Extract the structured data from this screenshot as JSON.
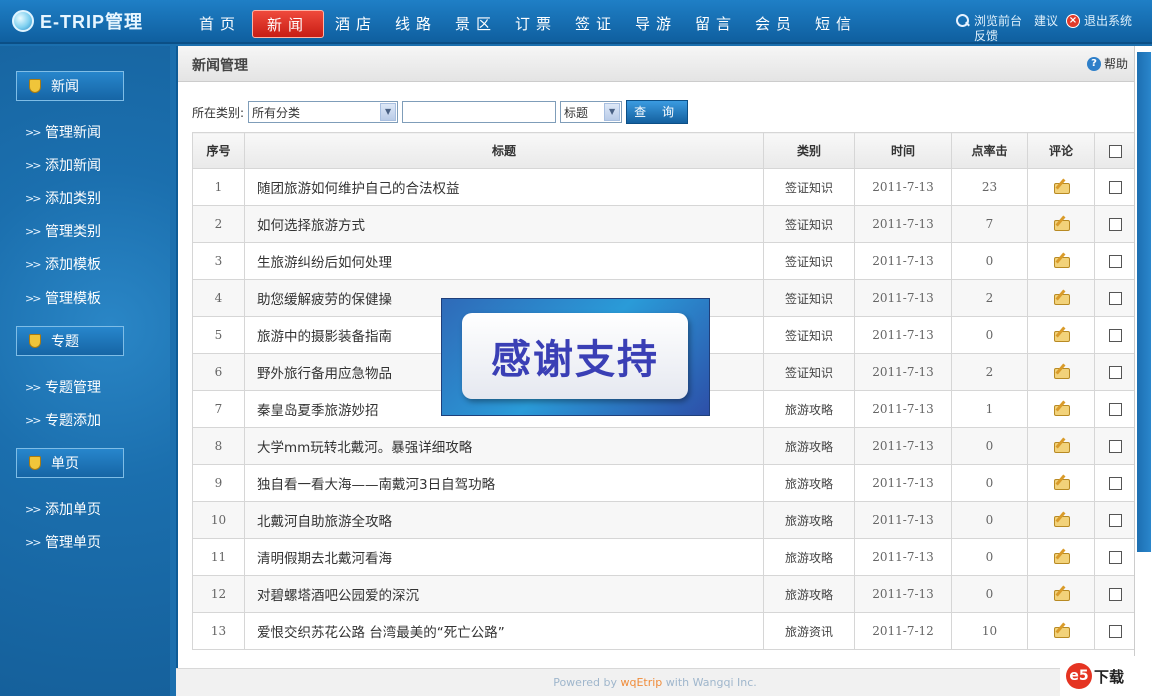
{
  "header": {
    "logo_text": "E-TRIP管理",
    "nav": [
      {
        "label": "首页",
        "active": false
      },
      {
        "label": "新闻",
        "active": true
      },
      {
        "label": "酒店",
        "active": false
      },
      {
        "label": "线路",
        "active": false
      },
      {
        "label": "景区",
        "active": false
      },
      {
        "label": "订票",
        "active": false
      },
      {
        "label": "签证",
        "active": false
      },
      {
        "label": "导游",
        "active": false
      },
      {
        "label": "留言",
        "active": false
      },
      {
        "label": "会员",
        "active": false
      },
      {
        "label": "短信",
        "active": false
      }
    ],
    "browse_label": "浏览前台反馈",
    "suggest_label": "建议",
    "exit_label": "退出系统"
  },
  "sidebar": {
    "sections": [
      {
        "title": "新闻",
        "items": [
          "管理新闻",
          "添加新闻",
          "添加类别",
          "管理类别",
          "添加模板",
          "管理模板"
        ]
      },
      {
        "title": "专题",
        "items": [
          "专题管理",
          "专题添加"
        ]
      },
      {
        "title": "单页",
        "items": [
          "添加单页",
          "管理单页"
        ]
      }
    ]
  },
  "main": {
    "title": "新闻管理",
    "help_label": "帮助",
    "filter": {
      "label": "所在类别:",
      "category_value": "所有分类",
      "search_value": "",
      "field_value": "标题",
      "query_label": "查 询"
    },
    "table": {
      "headers": [
        "序号",
        "标题",
        "类别",
        "时间",
        "点率击",
        "评论",
        ""
      ],
      "rows": [
        {
          "no": "1",
          "title": "随团旅游如何维护自己的合法权益",
          "cat": "签证知识",
          "time": "2011-7-13",
          "hits": "23"
        },
        {
          "no": "2",
          "title": "如何选择旅游方式",
          "cat": "签证知识",
          "time": "2011-7-13",
          "hits": "7"
        },
        {
          "no": "3",
          "title": "生旅游纠纷后如何处理",
          "cat": "签证知识",
          "time": "2011-7-13",
          "hits": "0"
        },
        {
          "no": "4",
          "title": "助您缓解疲劳的保健操",
          "cat": "签证知识",
          "time": "2011-7-13",
          "hits": "2"
        },
        {
          "no": "5",
          "title": "旅游中的摄影装备指南",
          "cat": "签证知识",
          "time": "2011-7-13",
          "hits": "0"
        },
        {
          "no": "6",
          "title": "野外旅行备用应急物品",
          "cat": "签证知识",
          "time": "2011-7-13",
          "hits": "2"
        },
        {
          "no": "7",
          "title": "秦皇岛夏季旅游妙招",
          "cat": "旅游攻略",
          "time": "2011-7-13",
          "hits": "1"
        },
        {
          "no": "8",
          "title": "大学mm玩转北戴河。暴强详细攻略",
          "cat": "旅游攻略",
          "time": "2011-7-13",
          "hits": "0"
        },
        {
          "no": "9",
          "title": "独自看一看大海——南戴河3日自驾功略",
          "cat": "旅游攻略",
          "time": "2011-7-13",
          "hits": "0"
        },
        {
          "no": "10",
          "title": "北戴河自助旅游全攻略",
          "cat": "旅游攻略",
          "time": "2011-7-13",
          "hits": "0"
        },
        {
          "no": "11",
          "title": "清明假期去北戴河看海",
          "cat": "旅游攻略",
          "time": "2011-7-13",
          "hits": "0"
        },
        {
          "no": "12",
          "title": "对碧螺塔酒吧公园爱的深沉",
          "cat": "旅游攻略",
          "time": "2011-7-13",
          "hits": "0"
        },
        {
          "no": "13",
          "title": "爱恨交织苏花公路 台湾最美的“死亡公路”",
          "cat": "旅游资讯",
          "time": "2011-7-12",
          "hits": "10"
        }
      ]
    }
  },
  "footer": {
    "prefix": "Powered by ",
    "brand": "wqEtrip",
    "mid": " with ",
    "company": "Wangqi",
    "suffix": " Inc."
  },
  "banner_text": "感谢支持",
  "watermark": {
    "mark": "e5",
    "text": "下载"
  }
}
